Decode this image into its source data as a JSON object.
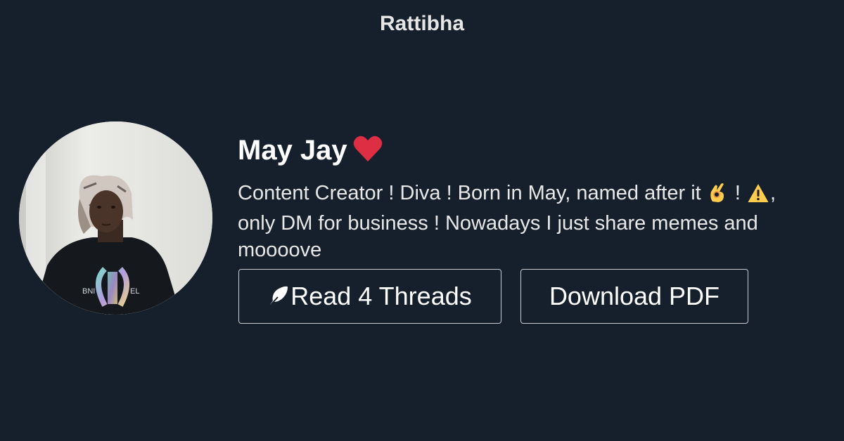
{
  "site": {
    "name": "Rattibha"
  },
  "profile": {
    "name": "May Jay",
    "name_icon": "red-heart-icon",
    "bio": {
      "line1_a": "Content Creator ! Diva ! Born in May, named after it",
      "line1_b": "!",
      "line1_c": ",",
      "line2": "only DM for business ! Nowadays I just share memes and",
      "line3": "moooove",
      "emoji1": "ok-hand-icon",
      "emoji2": "warning-icon"
    }
  },
  "actions": {
    "read_threads_label": "Read 4 Threads",
    "read_threads_icon": "feather-icon",
    "download_pdf_label": "Download PDF"
  },
  "colors": {
    "background": "#16202c",
    "text": "#ffffff",
    "heart": "#dd2e44",
    "button_border": "#c9ccd0"
  }
}
